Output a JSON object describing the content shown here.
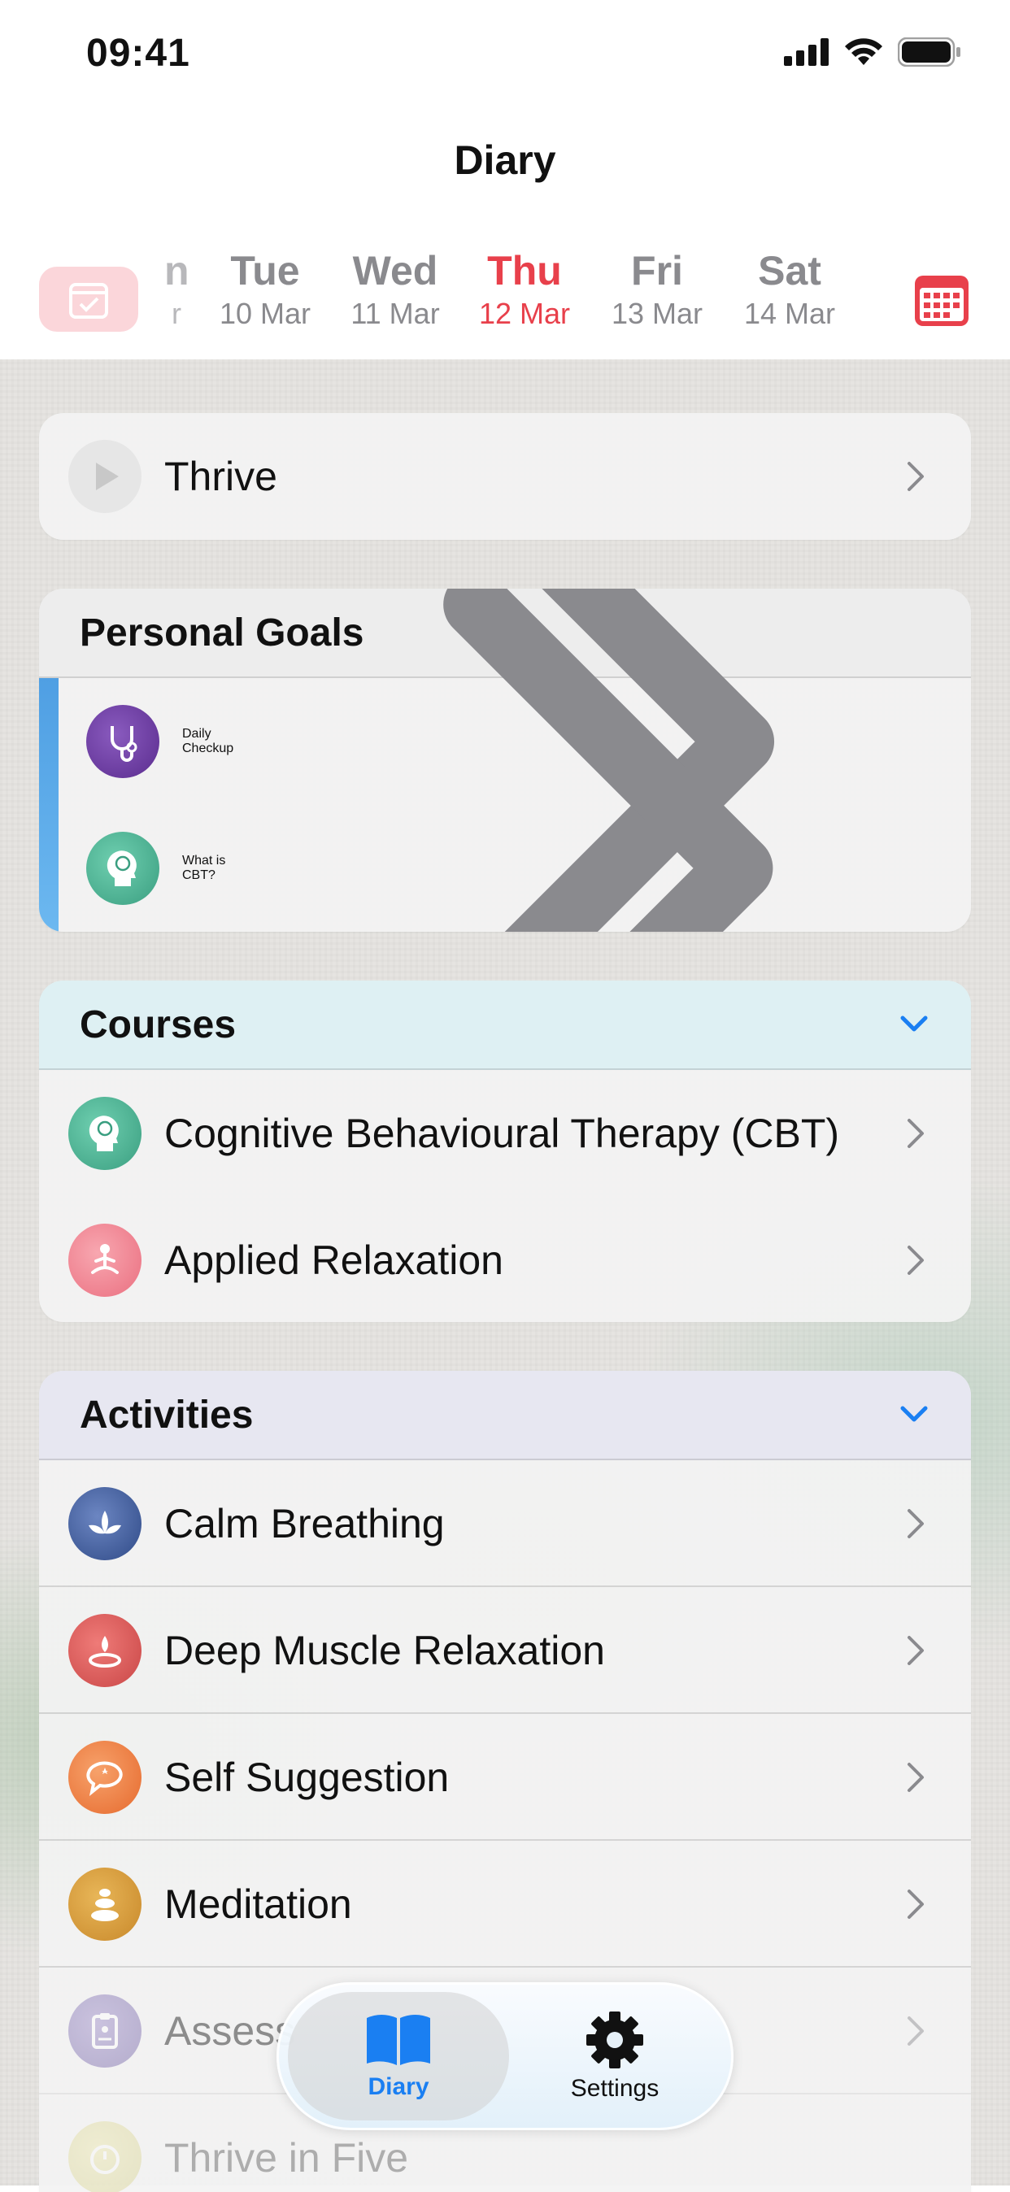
{
  "status": {
    "time": "09:41"
  },
  "header": {
    "title": "Diary"
  },
  "days": [
    {
      "name": "Tue",
      "date": "10 Mar"
    },
    {
      "name": "Wed",
      "date": "11 Mar"
    },
    {
      "name": "Thu",
      "date": "12 Mar"
    },
    {
      "name": "Fri",
      "date": "13 Mar"
    },
    {
      "name": "Sat",
      "date": "14 Mar"
    }
  ],
  "selected_day": "Thu",
  "thrive": {
    "label": "Thrive"
  },
  "personal_goals": {
    "title": "Personal Goals",
    "items": [
      {
        "label": "Daily Checkup",
        "icon": "stethoscope-icon"
      },
      {
        "label": "What is CBT?",
        "icon": "brain-head-icon"
      }
    ]
  },
  "courses": {
    "title": "Courses",
    "items": [
      {
        "label": "Cognitive Behavioural Therapy (CBT)",
        "icon": "brain-head-icon"
      },
      {
        "label": "Applied Relaxation",
        "icon": "meditation-person-icon"
      }
    ]
  },
  "activities": {
    "title": "Activities",
    "items": [
      {
        "label": "Calm Breathing",
        "icon": "lotus-icon"
      },
      {
        "label": "Deep Muscle Relaxation",
        "icon": "candle-icon"
      },
      {
        "label": "Self Suggestion",
        "icon": "speech-bubble-icon"
      },
      {
        "label": "Meditation",
        "icon": "stones-icon"
      },
      {
        "label": "Assess",
        "icon": "clipboard-icon"
      },
      {
        "label": "Thrive in Five",
        "icon": "timer-icon"
      }
    ]
  },
  "tabbar": {
    "diary": "Diary",
    "settings": "Settings"
  },
  "colors": {
    "accent": "#e8404b",
    "tint": "#1a7ff2"
  }
}
